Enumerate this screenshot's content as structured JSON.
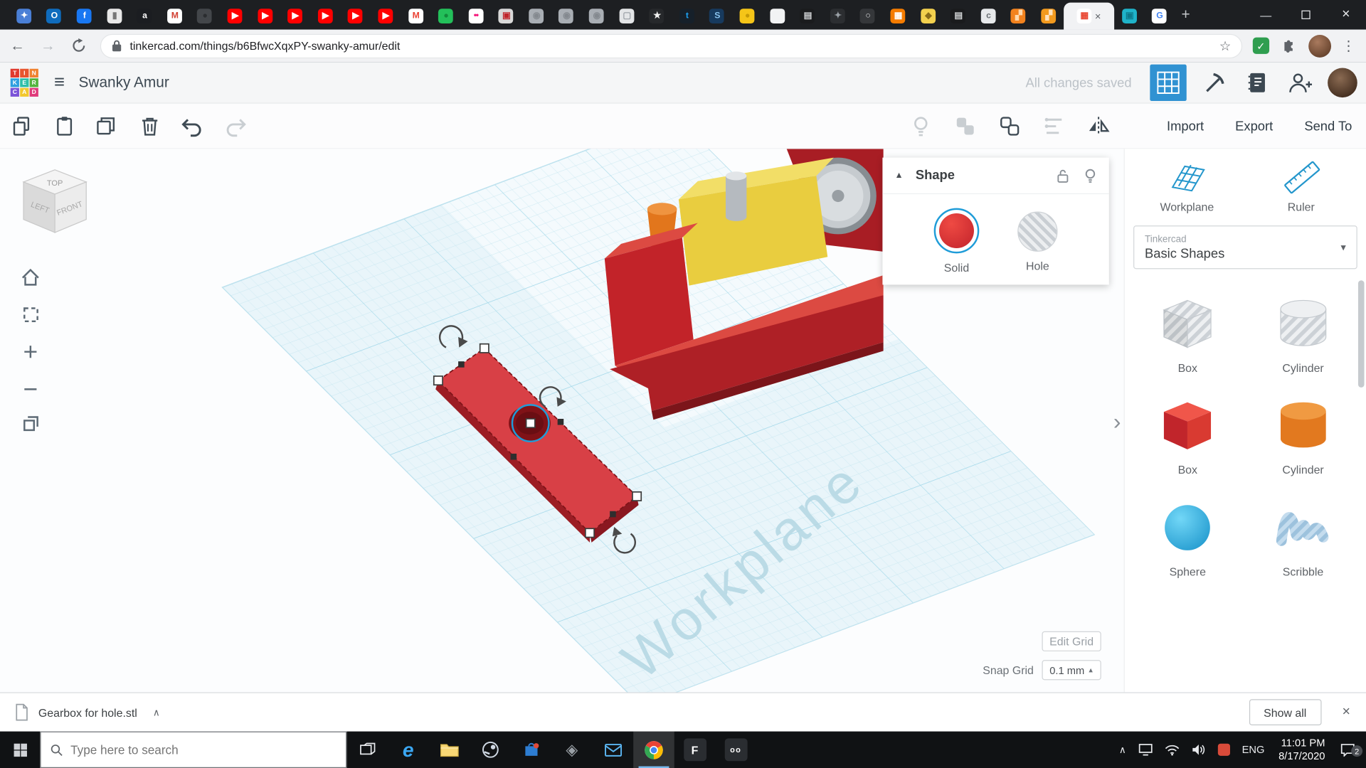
{
  "colors": {
    "accent_blue": "#1f9cd8",
    "solid_red": "#d6232e",
    "grid_blue": "#bcdfec",
    "taskbar_dark": "#101214"
  },
  "browser": {
    "tabs": [
      {
        "b": "#4a7fd6",
        "g": "✦",
        "c": "#ffffff",
        "x": ""
      },
      {
        "b": "#0f6cbd",
        "g": "O",
        "c": "#ffffff",
        "x": ""
      },
      {
        "b": "#1877f2",
        "g": "f",
        "c": "#ffffff",
        "x": ""
      },
      {
        "b": "#e9e9e9",
        "g": "▮",
        "c": "#777777",
        "x": ""
      },
      {
        "b": "#1b1d21",
        "g": "a",
        "c": "#ffffff",
        "x": ""
      },
      {
        "b": "#ffffff",
        "g": "M",
        "c": "#d23f31",
        "x": ""
      },
      {
        "b": "#43464a",
        "g": "●",
        "c": "#2b2d30",
        "x": ""
      },
      {
        "b": "#ff0000",
        "g": "▶",
        "c": "#ffffff",
        "x": ""
      },
      {
        "b": "#ff0000",
        "g": "▶",
        "c": "#ffffff",
        "x": ""
      },
      {
        "b": "#ff0000",
        "g": "▶",
        "c": "#ffffff",
        "x": ""
      },
      {
        "b": "#ff0000",
        "g": "▶",
        "c": "#ffffff",
        "x": ""
      },
      {
        "b": "#ff0000",
        "g": "▶",
        "c": "#ffffff",
        "x": ""
      },
      {
        "b": "#ff0000",
        "g": "▶",
        "c": "#ffffff",
        "x": ""
      },
      {
        "b": "#ffffff",
        "g": "M",
        "c": "#ea4335",
        "x": ""
      },
      {
        "b": "#23c05a",
        "g": "●",
        "c": "#128a3c",
        "x": ""
      },
      {
        "b": "#ffffff",
        "g": "••",
        "c": "#f5197c",
        "x": ""
      },
      {
        "b": "#d9d9d9",
        "g": "▣",
        "c": "#c0262c",
        "x": ""
      },
      {
        "b": "#a9aeb4",
        "g": "◉",
        "c": "#84898f",
        "x": ""
      },
      {
        "b": "#a9aeb4",
        "g": "◉",
        "c": "#84898f",
        "x": ""
      },
      {
        "b": "#a9aeb4",
        "g": "◉",
        "c": "#84898f",
        "x": ""
      },
      {
        "b": "#e3e5e7",
        "g": "▢",
        "c": "#9aa0a6",
        "x": ""
      },
      {
        "b": "#26282b",
        "g": "★",
        "c": "#f2f2f2",
        "x": ""
      },
      {
        "b": "#16202a",
        "g": "t",
        "c": "#1da1f2",
        "x": ""
      },
      {
        "b": "#173a5e",
        "g": "S",
        "c": "#8ac4ef",
        "x": ""
      },
      {
        "b": "#f5c518",
        "g": "●",
        "c": "#c79a06",
        "x": ""
      },
      {
        "b": "#f2f3f4",
        "g": "",
        "c": "#999999",
        "x": ""
      },
      {
        "b": "#1a1b1d",
        "g": "▤",
        "c": "#d2d4d6",
        "x": ""
      },
      {
        "b": "#2c2e31",
        "g": "✦",
        "c": "#9aa0a6",
        "x": ""
      },
      {
        "b": "#35373a",
        "g": "○",
        "c": "#e4e6e8",
        "x": ""
      },
      {
        "b": "#f57c00",
        "g": "▦",
        "c": "#ffffff",
        "x": ""
      },
      {
        "b": "#f3d14e",
        "g": "◆",
        "c": "#8a6d1a",
        "x": ""
      },
      {
        "b": "#1a1b1d",
        "g": "▤",
        "c": "#d2d4d6",
        "x": ""
      },
      {
        "b": "#e7e9eb",
        "g": "c",
        "c": "#6b7075",
        "x": ""
      },
      {
        "b": "#f2821e",
        "g": "▞",
        "c": "#ffd9ad",
        "x": ""
      },
      {
        "b": "#f29a1e",
        "g": "▞",
        "c": "#ffe3bd",
        "x": ""
      },
      {
        "b": "#ffffff",
        "g": "▦",
        "c": "#e8442e",
        "cls": "active",
        "x": "×"
      },
      {
        "b": "#1fb3c9",
        "g": "▣",
        "c": "#0d7a8c",
        "x": ""
      },
      {
        "b": "#ffffff",
        "g": "G",
        "c": "#4285f4",
        "x": ""
      }
    ],
    "new_tab": "+",
    "back": "←",
    "forward": "→",
    "url": "tinkercad.com/things/b6BfwcXqxPY-swanky-amur/edit",
    "bookmark_star": "☆",
    "ext_check": "✓",
    "menu_dots": "⋮",
    "window_min": "—",
    "window_close": "×"
  },
  "header": {
    "logo": [
      "T",
      "I",
      "N",
      "K",
      "E",
      "R",
      "C",
      "A",
      "D"
    ],
    "menu_icon": "≡",
    "title": "Swanky Amur",
    "status": "All changes saved"
  },
  "toolbar": {
    "import": "Import",
    "export": "Export",
    "send_to": "Send To"
  },
  "canvas": {
    "watermark": "Workplane",
    "viewcube": {
      "top": "TOP",
      "left": "LEFT",
      "front": "FRONT"
    },
    "edit_grid": "Edit Grid",
    "snap_label": "Snap Grid",
    "snap_value": "0.1 mm",
    "snap_caret": "▴",
    "collapse_chevron": "›"
  },
  "shape_panel": {
    "title": "Shape",
    "collapse": "▲",
    "solid_label": "Solid",
    "hole_label": "Hole"
  },
  "sidebar": {
    "workplane": "Workplane",
    "ruler": "Ruler",
    "brand": "Tinkercad",
    "category": "Basic Shapes",
    "caret": "▾",
    "shapes": [
      "Box",
      "Cylinder",
      "Box",
      "Cylinder",
      "Sphere",
      "Scribble"
    ]
  },
  "download_bar": {
    "filename": "Gearbox for hole.stl",
    "chevron": "∧",
    "show_all": "Show all",
    "close": "×"
  },
  "taskbar": {
    "search_placeholder": "Type here to search",
    "lang": "ENG",
    "time": "11:01 PM",
    "date": "8/17/2020",
    "badge": "2",
    "tray_chevron": "∧"
  }
}
